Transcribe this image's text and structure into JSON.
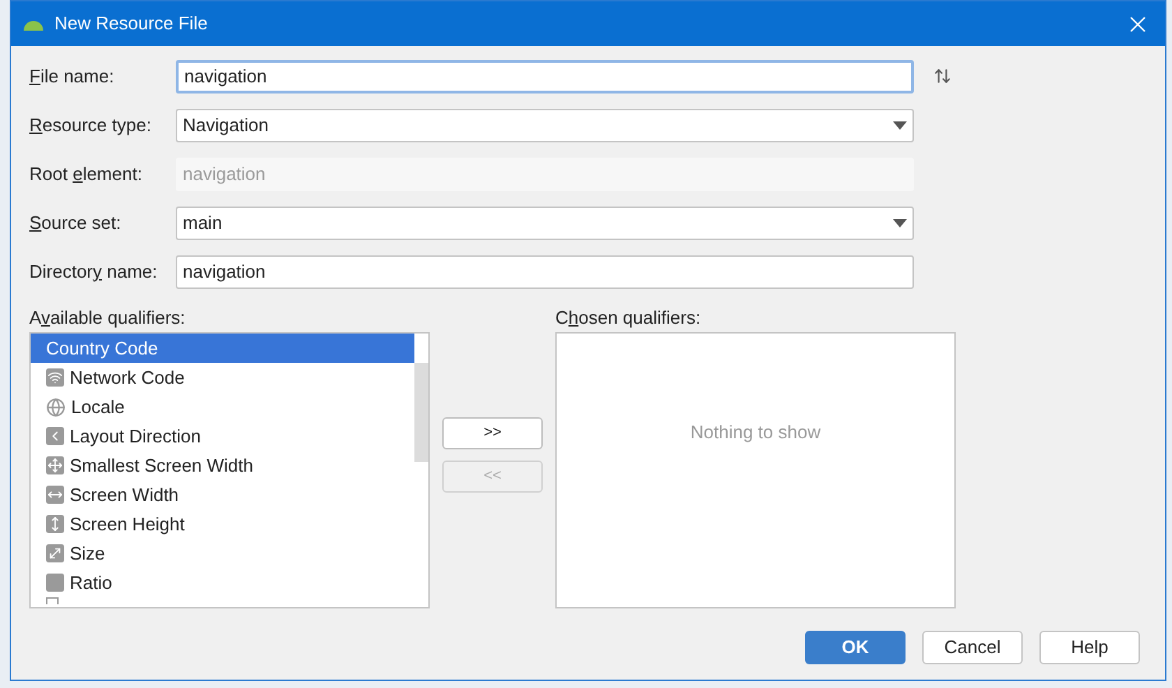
{
  "window": {
    "title": "New Resource File"
  },
  "fields": [
    {
      "kind": "text",
      "label": {
        "key": "F",
        "after": "ile name:"
      },
      "value": "navigation",
      "focused": true,
      "disabled": false
    },
    {
      "kind": "dropdown",
      "label": {
        "key": "R",
        "after": "esource type:"
      },
      "value": "Navigation",
      "focused": false,
      "disabled": false
    },
    {
      "kind": "text",
      "label": {
        "before": "Root ",
        "key": "e",
        "after": "lement:"
      },
      "value": "navigation",
      "focused": false,
      "disabled": true
    },
    {
      "kind": "dropdown",
      "label": {
        "key": "S",
        "after": "ource set:"
      },
      "value": "main",
      "focused": false,
      "disabled": false
    },
    {
      "kind": "text",
      "label": {
        "before": "Director",
        "key": "y",
        "after": " name:"
      },
      "value": "navigation",
      "focused": false,
      "disabled": false
    }
  ],
  "available": {
    "label": {
      "before": "A",
      "key": "v",
      "after": "ailable qualifiers:"
    },
    "items": [
      {
        "name": "Country Code",
        "selected": true
      },
      {
        "name": "Network Code",
        "selected": false
      },
      {
        "name": "Locale",
        "selected": false
      },
      {
        "name": "Layout Direction",
        "selected": false
      },
      {
        "name": "Smallest Screen Width",
        "selected": false
      },
      {
        "name": "Screen Width",
        "selected": false
      },
      {
        "name": "Screen Height",
        "selected": false
      },
      {
        "name": "Size",
        "selected": false
      },
      {
        "name": "Ratio",
        "selected": false
      }
    ]
  },
  "move_buttons": [
    {
      "label": ">>",
      "disabled": false
    },
    {
      "label": "<<",
      "disabled": true
    }
  ],
  "chosen": {
    "label": {
      "before": "C",
      "key": "h",
      "after": "osen qualifiers:"
    },
    "empty_text": "Nothing to show"
  },
  "buttons": [
    {
      "label": "OK",
      "kind": "primary"
    },
    {
      "label": "Cancel",
      "kind": "normal"
    },
    {
      "label": "Help",
      "kind": "normal"
    }
  ]
}
